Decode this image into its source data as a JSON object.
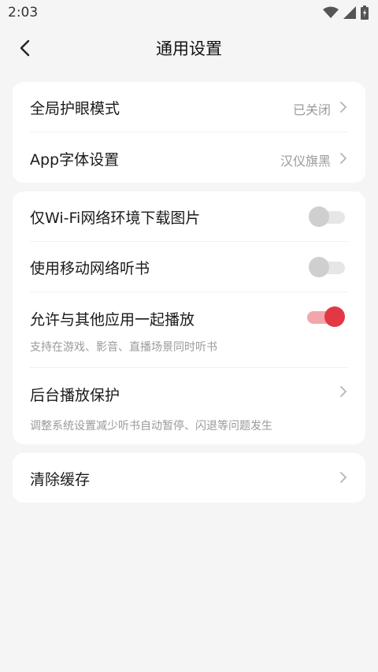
{
  "status_bar": {
    "time": "2:03",
    "icons": [
      "wifi-icon",
      "signal-icon",
      "battery-icon"
    ]
  },
  "header": {
    "title": "通用设置",
    "back_icon": "chevron-left-icon"
  },
  "card_display": {
    "eye_mode": {
      "label": "全局护眼模式",
      "value": "已关闭"
    },
    "font": {
      "label": "App字体设置",
      "value": "汉仪旗黑"
    }
  },
  "card_playback": {
    "wifi_download": {
      "label": "仅Wi-Fi网络环境下载图片",
      "on": false
    },
    "mobile_listen": {
      "label": "使用移动网络听书",
      "on": false
    },
    "mix_play": {
      "label": "允许与其他应用一起播放",
      "sub": "支持在游戏、影音、直播场景同时听书",
      "on": true
    },
    "bg_protect": {
      "label": "后台播放保护",
      "sub": "调整系统设置减少听书自动暂停、闪退等问题发生"
    }
  },
  "card_cache": {
    "clear": {
      "label": "清除缓存"
    }
  },
  "colors": {
    "accent": "#e23845",
    "accent_light": "#f2a6ac",
    "background": "#f5f5f5"
  }
}
